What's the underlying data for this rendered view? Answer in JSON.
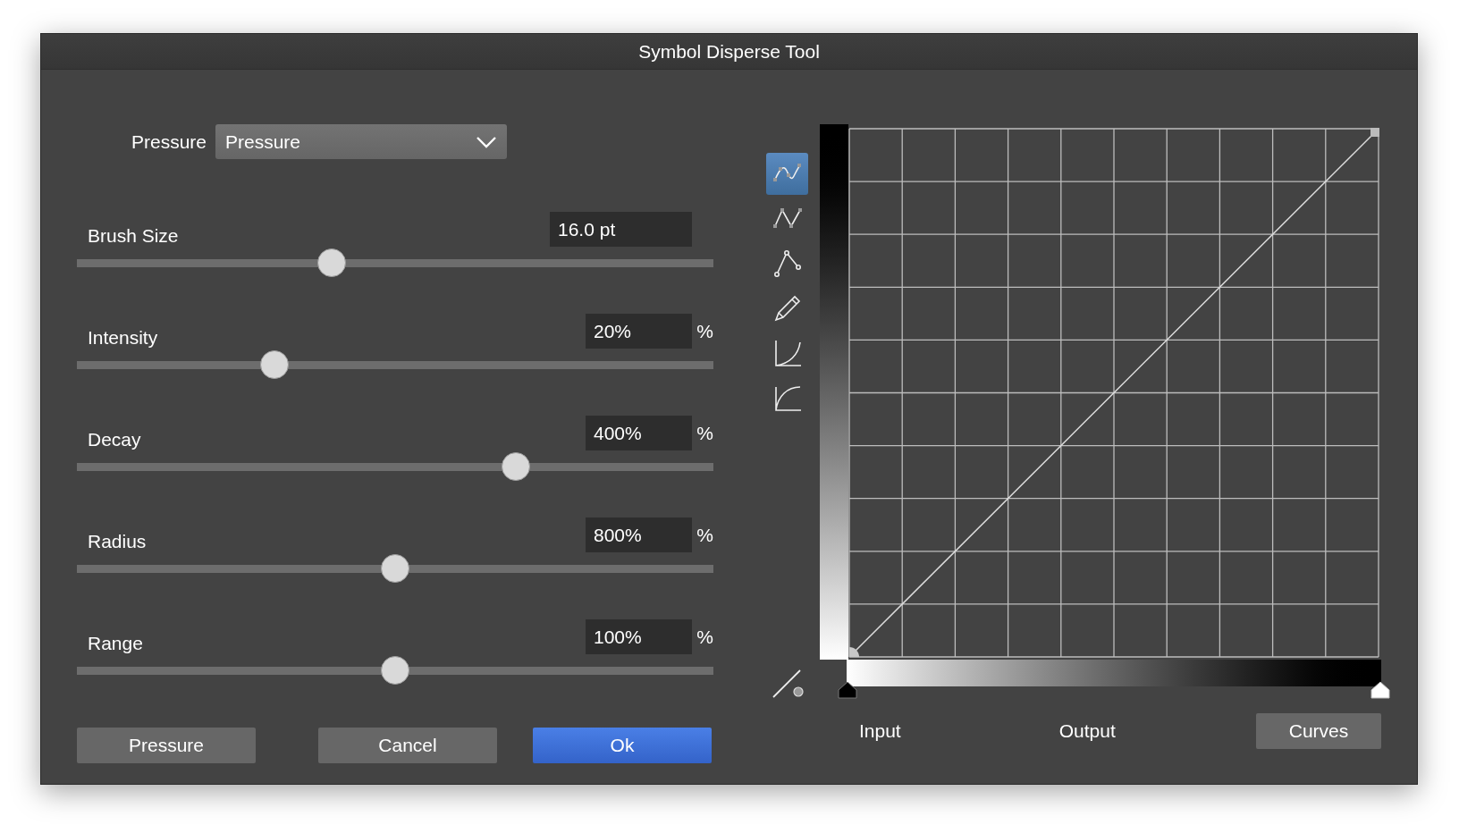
{
  "window": {
    "title": "Symbol Disperse Tool"
  },
  "controller": {
    "label": "Pressure",
    "value": "Pressure"
  },
  "sliders": [
    {
      "label": "Brush Size",
      "value": "16.0 pt",
      "level": 0.4
    },
    {
      "label": "Intensity",
      "value": "20%",
      "unit": "%",
      "level": 0.31
    },
    {
      "label": "Decay",
      "value": "400%",
      "unit": "%",
      "level": 0.69
    },
    {
      "label": "Radius",
      "value": "800%",
      "unit": "%",
      "level": 0.5
    },
    {
      "label": "Range",
      "value": "100%",
      "unit": "%",
      "level": 0.5
    }
  ],
  "buttons": [
    {
      "label": "Pressure",
      "kind": "normal"
    },
    {
      "label": "Cancel",
      "kind": "normal"
    },
    {
      "label": "Ok",
      "kind": "default"
    }
  ],
  "curve_tools": [
    {
      "kind": "smooth-nodes",
      "selected": true
    },
    {
      "kind": "sharp-nodes",
      "selected": false
    },
    {
      "kind": "polyline",
      "selected": false
    },
    {
      "kind": "pencil",
      "selected": false
    },
    {
      "kind": "ease-in",
      "selected": false
    },
    {
      "kind": "ease-out",
      "selected": false
    }
  ],
  "graph": {
    "input_label": "Input",
    "output_label": "Output",
    "button": "Curves"
  }
}
